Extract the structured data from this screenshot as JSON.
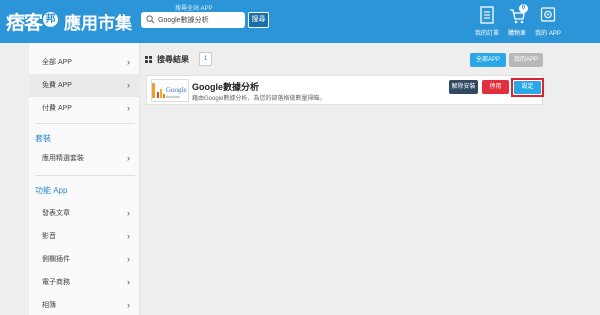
{
  "header": {
    "logo_text_left": "痞客",
    "logo_badge": "邦",
    "logo_text_right": "應用市集",
    "search_caption": "搜尋全站 APP",
    "search_value": "Google數據分析",
    "search_button": "搜尋",
    "nav": [
      {
        "label": "我的訂單",
        "icon": "order-list-icon"
      },
      {
        "label": "購物車",
        "icon": "cart-icon",
        "count": "0"
      },
      {
        "label": "我的 APP",
        "icon": "my-app-icon"
      }
    ],
    "accent_color": "#2b95d8"
  },
  "sidebar": {
    "top_items": [
      "全部 APP",
      "免費 APP",
      "付費 APP"
    ],
    "section_bundle": "套裝",
    "bundle_items": [
      "應用精選套裝"
    ],
    "section_function": "功能 App",
    "function_items": [
      "發表文章",
      "影音",
      "側欄插件",
      "電子商務",
      "相簿"
    ]
  },
  "main": {
    "title": "搜尋結果",
    "page": "1",
    "all_app_button": "全部APP",
    "my_app_button": "我的APP",
    "result": {
      "title": "Google數據分析",
      "description": "藉由Google數據分析，為您的部落格做數量掃瞄。",
      "thumb_logo": "Google",
      "thumb_sub": "Analytics",
      "uninstall_button": "解除安裝",
      "disable_button": "停用",
      "settings_button": "設定"
    }
  },
  "chevron": "›"
}
